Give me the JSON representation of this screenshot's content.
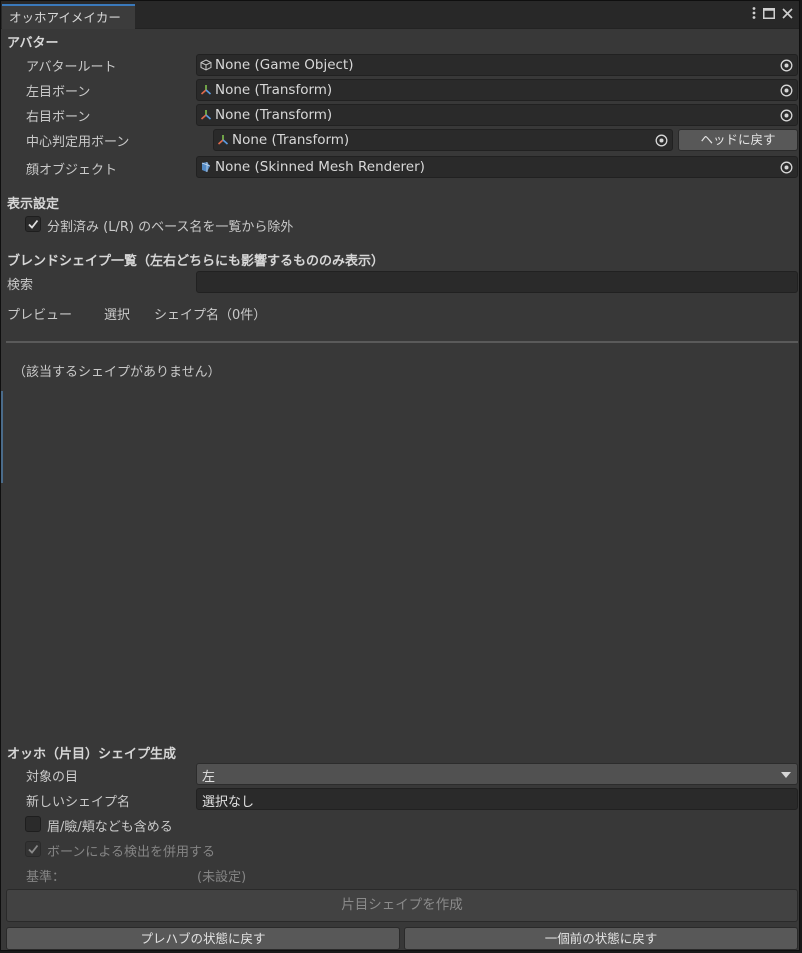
{
  "window": {
    "tab_title": "オッホアイメイカー"
  },
  "avatar_section": {
    "header": "アバター",
    "rows": [
      {
        "label": "アバタールート",
        "value": "None (Game Object)",
        "icon": "game-object-icon"
      },
      {
        "label": "左目ボーン",
        "value": "None (Transform)",
        "icon": "transform-icon"
      },
      {
        "label": "右目ボーン",
        "value": "None (Transform)",
        "icon": "transform-icon"
      },
      {
        "label": "中心判定用ボーン",
        "value": "None (Transform)",
        "icon": "transform-icon"
      },
      {
        "label": "顔オブジェクト",
        "value": "None (Skinned Mesh Renderer)",
        "icon": "skinned-mesh-icon"
      }
    ],
    "head_button": "ヘッドに戻す"
  },
  "display_section": {
    "header": "表示設定",
    "exclude_checkbox_label": "分割済み (L/R) のベース名を一覧から除外",
    "exclude_checked": true
  },
  "blendshape_section": {
    "header": "ブレンドシェイプ一覧（左右どちらにも影響するもののみ表示）",
    "search_label": "検索",
    "search_value": "",
    "columns": [
      "プレビュー",
      "選択",
      "シェイプ名（0件）"
    ],
    "empty_message": "（該当するシェイプがありません）"
  },
  "generate_section": {
    "header": "オッホ（片目）シェイプ生成",
    "target_eye_label": "対象の目",
    "target_eye_value": "左",
    "new_shape_label": "新しいシェイプ名",
    "new_shape_value": "選択なし",
    "include_brows_label": "眉/瞼/頬なども含める",
    "include_brows_checked": false,
    "use_bone_label": "ボーンによる検出を併用する",
    "use_bone_checked": true,
    "baseline_label": "基準：",
    "baseline_value": "(未設定)",
    "create_button": "片目シェイプを作成",
    "revert_prefab_button": "プレハブの状態に戻す",
    "revert_previous_button": "一個前の状態に戻す"
  },
  "colors": {
    "background": "#383838",
    "field": "#2a2a2a",
    "button": "#585858",
    "accent_tab": "#3a79bb"
  }
}
